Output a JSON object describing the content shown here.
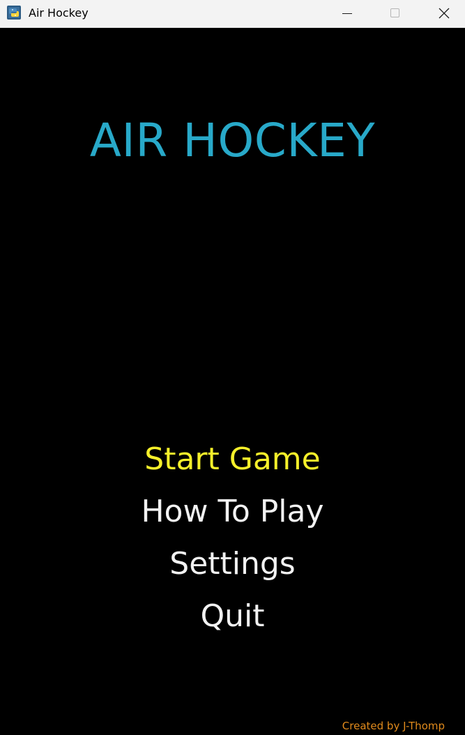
{
  "window": {
    "title": "Air Hockey",
    "app_icon": "python-icon",
    "controls": {
      "minimize_icon": "minimize-icon",
      "maximize_icon": "maximize-icon",
      "close_icon": "close-icon"
    }
  },
  "game": {
    "title": "AIR HOCKEY",
    "title_color": "#28a9c9",
    "menu": [
      {
        "label": "Start Game",
        "selected": true
      },
      {
        "label": "How To Play",
        "selected": false
      },
      {
        "label": "Settings",
        "selected": false
      },
      {
        "label": "Quit",
        "selected": false
      }
    ],
    "selected_color": "#f6f02a",
    "menu_color": "#f2f2f2",
    "credit": "Created by J-Thomp",
    "credit_color": "#e08a1c",
    "background_color": "#000000"
  }
}
